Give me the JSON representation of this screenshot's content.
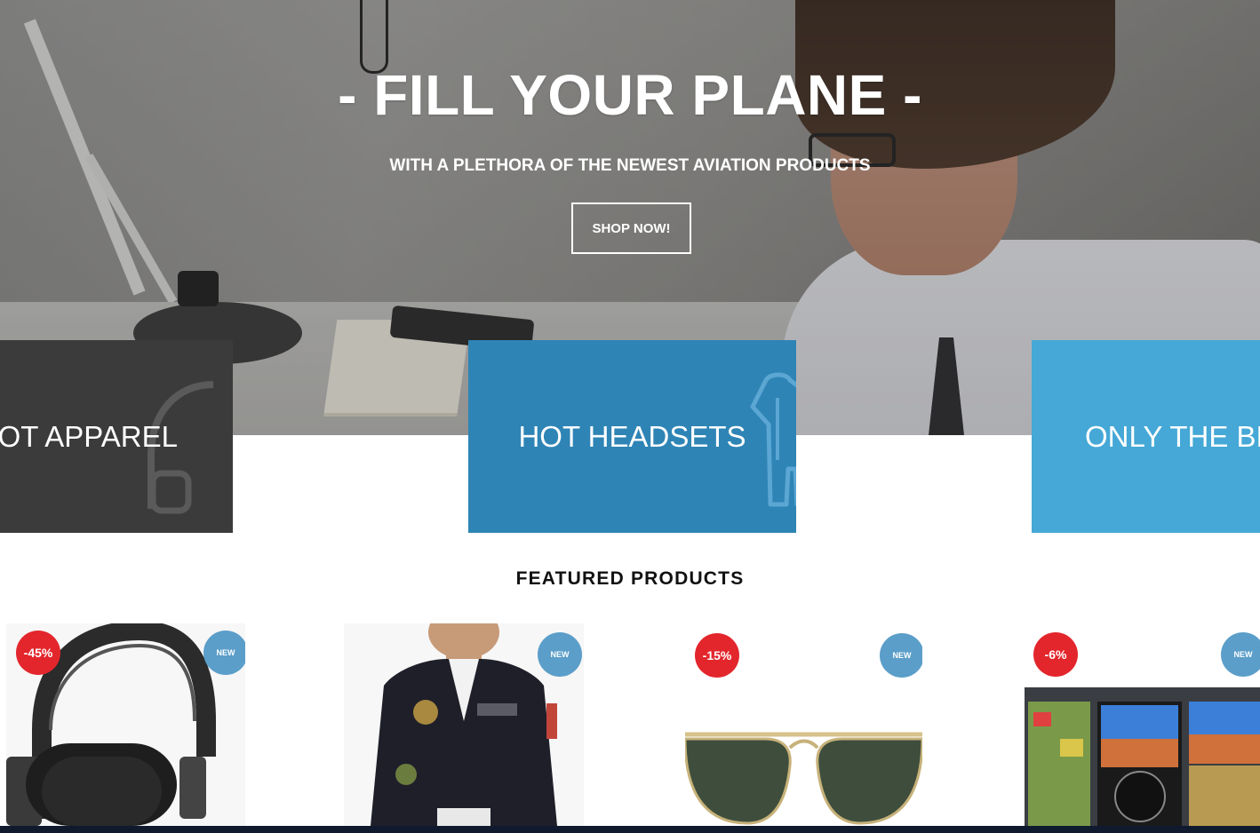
{
  "hero": {
    "title": "- FILL YOUR PLANE -",
    "subtitle": "WITH A PLETHORA OF THE NEWEST AVIATION PRODUCTS",
    "cta_label": "SHOP NOW!"
  },
  "categories": [
    {
      "label": "PILOT APPAREL",
      "visible_label": "LOT APPAREL",
      "icon": "headset-icon",
      "color": "#3b3b3b"
    },
    {
      "label": "HOT HEADSETS",
      "visible_label": "HOT HEADSETS",
      "icon": "flight-suit-icon",
      "color": "#2e84b5"
    },
    {
      "label": "ONLY THE BEST",
      "visible_label": "ONLY THE BE",
      "icon": "",
      "color": "#45a8d6"
    }
  ],
  "featured": {
    "title": "FEATURED PRODUCTS",
    "products": [
      {
        "image": "headphones",
        "discount": "-45%",
        "new_label": "NEW"
      },
      {
        "image": "flight-jacket",
        "discount": "",
        "new_label": "NEW"
      },
      {
        "image": "aviator-sunglasses",
        "discount": "-15%",
        "new_label": "NEW"
      },
      {
        "image": "avionics-display",
        "discount": "-6%",
        "new_label": "NEW"
      }
    ]
  },
  "colors": {
    "sale_badge": "#e3262c",
    "new_badge": "#5b9ec9",
    "footer": "#0f1a2e"
  }
}
